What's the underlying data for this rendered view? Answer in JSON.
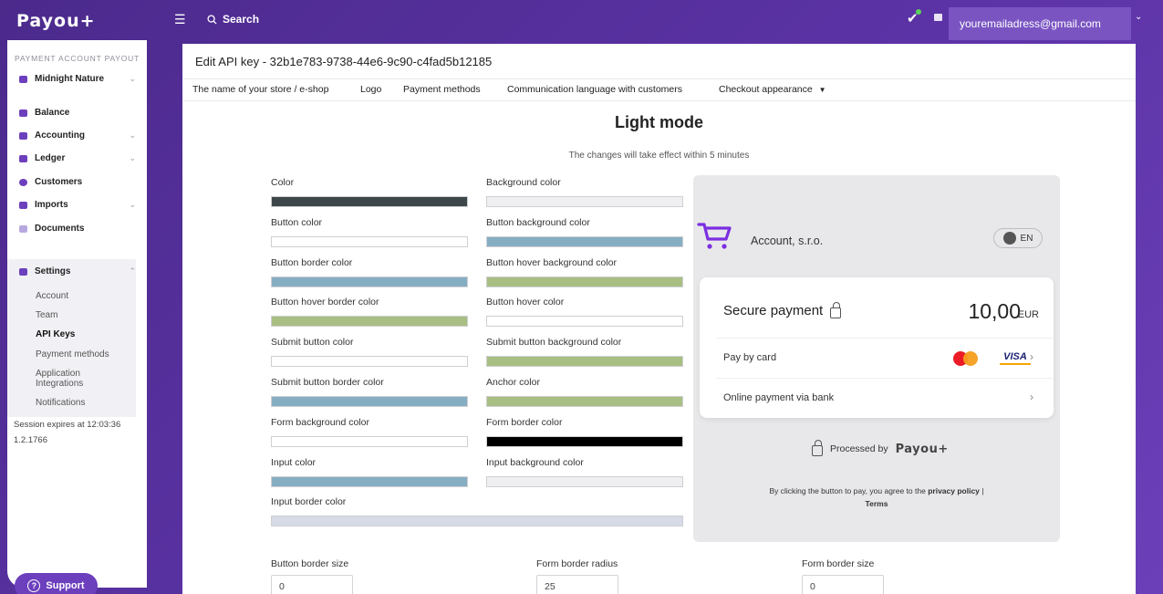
{
  "topbar": {
    "logo": "Payou+",
    "search_label": "Search",
    "user_email": "youremailadress@gmail.com"
  },
  "sidebar": {
    "section_label": "PAYMENT ACCOUNT PAYOUT",
    "account_switcher": "Midnight Nature",
    "items": [
      {
        "label": "Balance",
        "icon": "wallet-icon"
      },
      {
        "label": "Accounting",
        "icon": "accounting-icon"
      },
      {
        "label": "Ledger",
        "icon": "ledger-icon"
      },
      {
        "label": "Customers",
        "icon": "customers-icon"
      },
      {
        "label": "Imports",
        "icon": "upload-icon"
      },
      {
        "label": "Documents",
        "icon": "folder-icon"
      }
    ],
    "settings_label": "Settings",
    "settings_sub": [
      "Account",
      "Team",
      "API Keys",
      "Payment methods",
      "Application Integrations",
      "Notifications"
    ],
    "session_text": "Session expires at 12:03:36",
    "version": "1.2.1766",
    "support_label": "Support"
  },
  "main": {
    "title": "Edit API key - 32b1e783-9738-44e6-9c90-c4fad5b12185",
    "tabs": [
      "The name of your store / e-shop",
      "Logo",
      "Payment methods",
      "Communication language with customers",
      "Checkout appearance"
    ],
    "mode_title": "Light mode",
    "mode_subtitle": "The changes will take effect within 5 minutes",
    "color_fields": [
      {
        "label": "Color",
        "color": "#3d474a"
      },
      {
        "label": "Background color",
        "color": "#efeff1"
      },
      {
        "label": "Button color",
        "color": "#ffffff"
      },
      {
        "label": "Button background color",
        "color": "#86aec3"
      },
      {
        "label": "Button border color",
        "color": "#86aec3"
      },
      {
        "label": "Button hover background color",
        "color": "#a8be82"
      },
      {
        "label": "Button hover border color",
        "color": "#a8be82"
      },
      {
        "label": "Button hover color",
        "color": "#ffffff"
      },
      {
        "label": "Submit button color",
        "color": "#ffffff"
      },
      {
        "label": "Submit button background color",
        "color": "#a8be82"
      },
      {
        "label": "Submit button border color",
        "color": "#86aec3"
      },
      {
        "label": "Anchor color",
        "color": "#a8be82"
      },
      {
        "label": "Form background color",
        "color": "#ffffff"
      },
      {
        "label": "Form border color",
        "color": "#000000"
      },
      {
        "label": "Input color",
        "color": "#86aec3"
      },
      {
        "label": "Input background color",
        "color": "#efeff1"
      },
      {
        "label": "Input border color",
        "color": "#d6dbe6"
      }
    ],
    "number_fields": [
      {
        "label": "Button border size",
        "value": "0"
      },
      {
        "label": "Form border radius",
        "value": "25"
      },
      {
        "label": "Form border size",
        "value": "0"
      }
    ]
  },
  "preview": {
    "merchant": "Account, s.r.o.",
    "language": "EN",
    "secure_label": "Secure payment",
    "amount": "10,00",
    "currency": "EUR",
    "pay_by_card": "Pay by card",
    "online_bank": "Online payment via bank",
    "card_brand": "VISA",
    "processed_by": "Processed by",
    "brand": "Payou+",
    "legal_prefix": "By clicking the button to pay, you agree to the",
    "legal_privacy": "privacy policy",
    "legal_sep": "|",
    "legal_terms": "Terms"
  },
  "colors": {
    "brand_purple": "#6c3fbd",
    "cart_purple": "#7b2fe0"
  }
}
